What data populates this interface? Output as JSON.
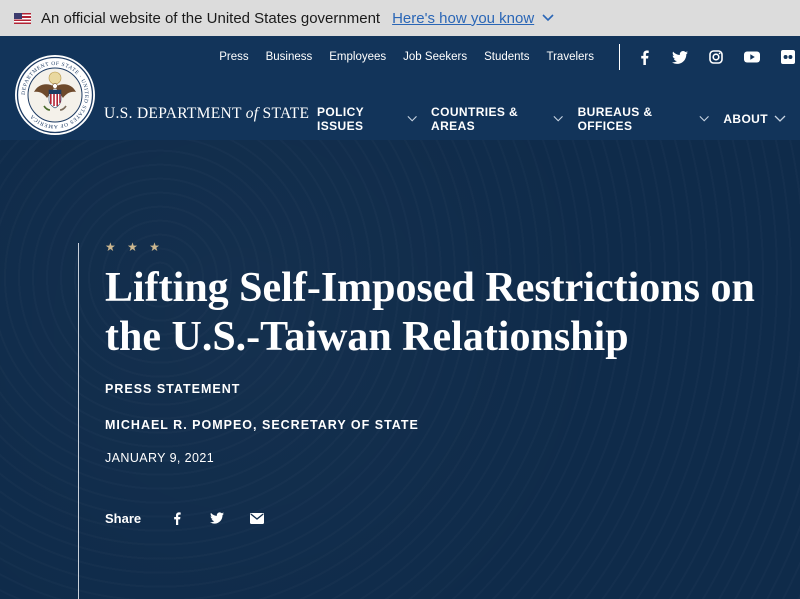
{
  "gov_banner": {
    "text": "An official website of the United States government",
    "link": "Here's how you know"
  },
  "header": {
    "utility_nav": [
      "Press",
      "Business",
      "Employees",
      "Job Seekers",
      "Students",
      "Travelers"
    ],
    "social_icons": [
      "facebook-icon",
      "twitter-icon",
      "instagram-icon",
      "youtube-icon",
      "flickr-icon"
    ],
    "brand_pre": "U.S. DEPARTMENT ",
    "brand_of": "of",
    "brand_post": " STATE",
    "seal_text": "DEPARTMENT OF STATE · UNITED STATES OF AMERICA",
    "main_nav": [
      "POLICY ISSUES",
      "COUNTRIES & AREAS",
      "BUREAUS & OFFICES",
      "ABOUT"
    ]
  },
  "article": {
    "stars": "★ ★ ★",
    "title": "Lifting Self-Imposed Restrictions on the U.S.-Taiwan Relationship",
    "type": "PRESS STATEMENT",
    "author": "MICHAEL R. POMPEO, SECRETARY OF STATE",
    "date": "JANUARY 9, 2021",
    "share_label": "Share",
    "share_icons": [
      "facebook-icon",
      "twitter-icon",
      "email-icon"
    ]
  },
  "colors": {
    "banner_bg": "#dcdcdc",
    "header_bg": "#12345a",
    "hero_bg": "#0f2b4a",
    "link": "#2a66b6",
    "star_gold": "#cdb890"
  }
}
